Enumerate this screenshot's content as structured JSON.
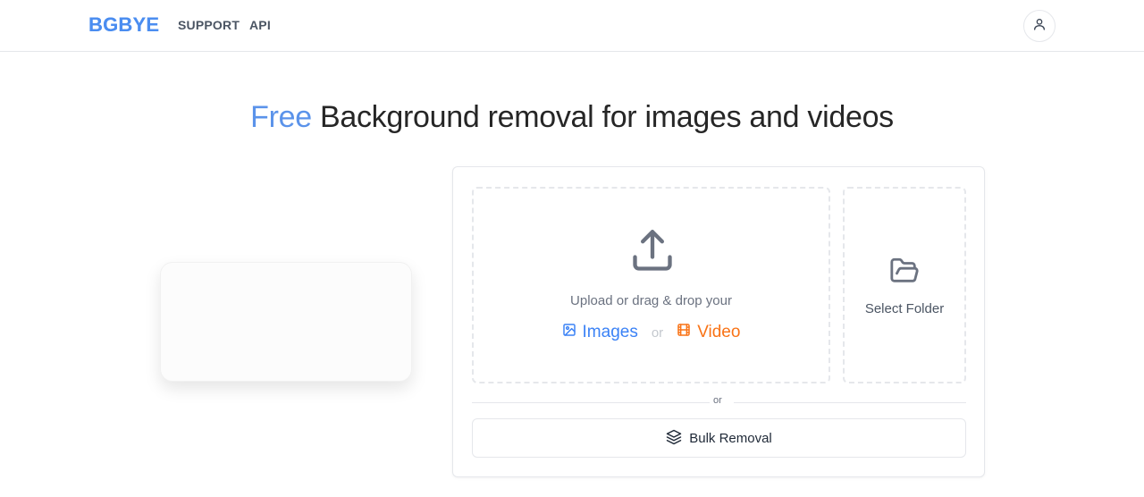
{
  "header": {
    "logo": "BGBYE",
    "nav": [
      {
        "label": "SUPPORT"
      },
      {
        "label": "API"
      }
    ],
    "account_icon": "user-icon"
  },
  "hero": {
    "accent": "Free",
    "title_rest": " Background removal for images and videos"
  },
  "upload": {
    "prompt": "Upload or drag & drop your",
    "images_label": "Images",
    "or_label": "or",
    "video_label": "Video",
    "upload_icon": "upload-icon",
    "images_icon": "image-icon",
    "video_icon": "film-icon"
  },
  "folder": {
    "label": "Select Folder",
    "icon": "folder-open-icon"
  },
  "divider": {
    "label": "or"
  },
  "bulk": {
    "label": "Bulk Removal",
    "icon": "layers-icon"
  },
  "colors": {
    "accent_blue": "#5b93ea",
    "images_blue": "#3b82f6",
    "video_orange": "#f97316",
    "border": "#e5e7eb"
  }
}
